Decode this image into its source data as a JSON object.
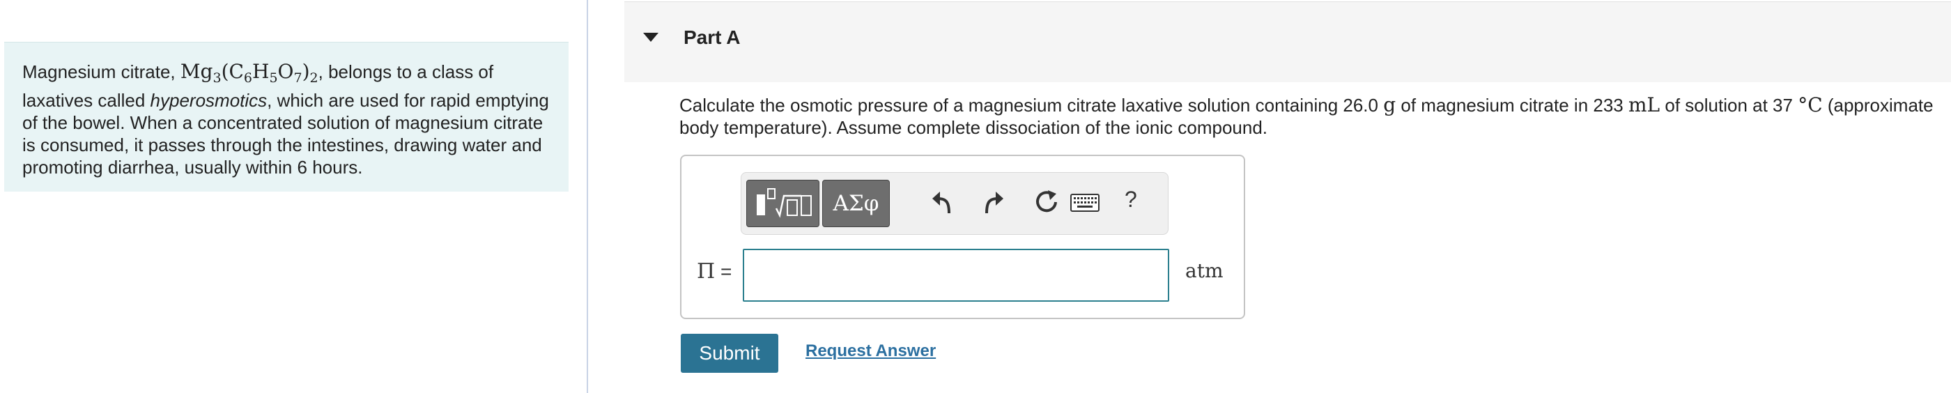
{
  "intro": {
    "t1": "Magnesium citrate, ",
    "formula": {
      "mg": "Mg",
      "mg_sub": "3",
      "open": "(C",
      "c_sub": "6",
      "h": "H",
      "h_sub": "5",
      "o": "O",
      "o_sub": "7",
      "close": ")",
      "close_sub": "2"
    },
    "t2": ", belongs to a class of laxatives called ",
    "italic": "hyperosmotics",
    "t3": ", which are used for rapid emptying of the bowel. When a concentrated solution of magnesium citrate is consumed, it passes through the intestines, drawing water and promoting diarrhea, usually within 6 hours."
  },
  "part": {
    "title": "Part A",
    "toggle_icon": "caret-down-icon"
  },
  "question": {
    "t1": "Calculate the osmotic pressure of a magnesium citrate laxative solution containing 26.0 ",
    "unit_g": "g",
    "t2": " of magnesium citrate in 233 ",
    "unit_ml": "mL",
    "t3": " of solution at 37 ",
    "unit_c": "°C",
    "t4": " (approximate body temperature). Assume complete dissociation of the ionic compound."
  },
  "toolbar": {
    "templates_icon": "templates-icon",
    "greek_label": "ΑΣφ",
    "undo_icon": "undo-icon",
    "redo_icon": "redo-icon",
    "reset_icon": "reset-icon",
    "keyboard_icon": "keyboard-icon",
    "help_label": "?"
  },
  "answer": {
    "variable": "Π",
    "equals": " =",
    "value": "",
    "unit": "atm"
  },
  "actions": {
    "submit_label": "Submit",
    "request_label": "Request Answer"
  },
  "colors": {
    "accent": "#2b7393",
    "input_border": "#2b7f8e",
    "panel_bg": "#e8f4f5",
    "link": "#2b6fa0"
  }
}
